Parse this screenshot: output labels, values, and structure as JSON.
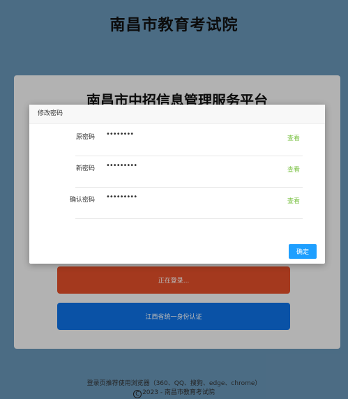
{
  "page": {
    "org_title": "南昌市教育考试院"
  },
  "login_card": {
    "platform_title": "南昌市中招信息管理服务平台",
    "login_button": "正在登录...",
    "sso_button": "江西省统一身份认证"
  },
  "footer": {
    "browser_tip": "登录页推荐使用浏览器（360、QQ、搜狗、edge、chrome）",
    "copyright_symbol": "C",
    "copyright_text": "2023 - 南昌市教育考试院"
  },
  "modal": {
    "title": "修改密码",
    "fields": [
      {
        "label": "原密码",
        "value": "••••••••",
        "action": "查看"
      },
      {
        "label": "新密码",
        "value": "•••••••••",
        "action": "查看"
      },
      {
        "label": "确认密码",
        "value": "•••••••••",
        "action": "查看"
      }
    ],
    "confirm_button": "确定"
  },
  "colors": {
    "background": "#6996b7",
    "login_button": "#e4502a",
    "sso_button": "#0f72e6",
    "view_link": "#7ac143",
    "confirm_button": "#1e9fff"
  }
}
